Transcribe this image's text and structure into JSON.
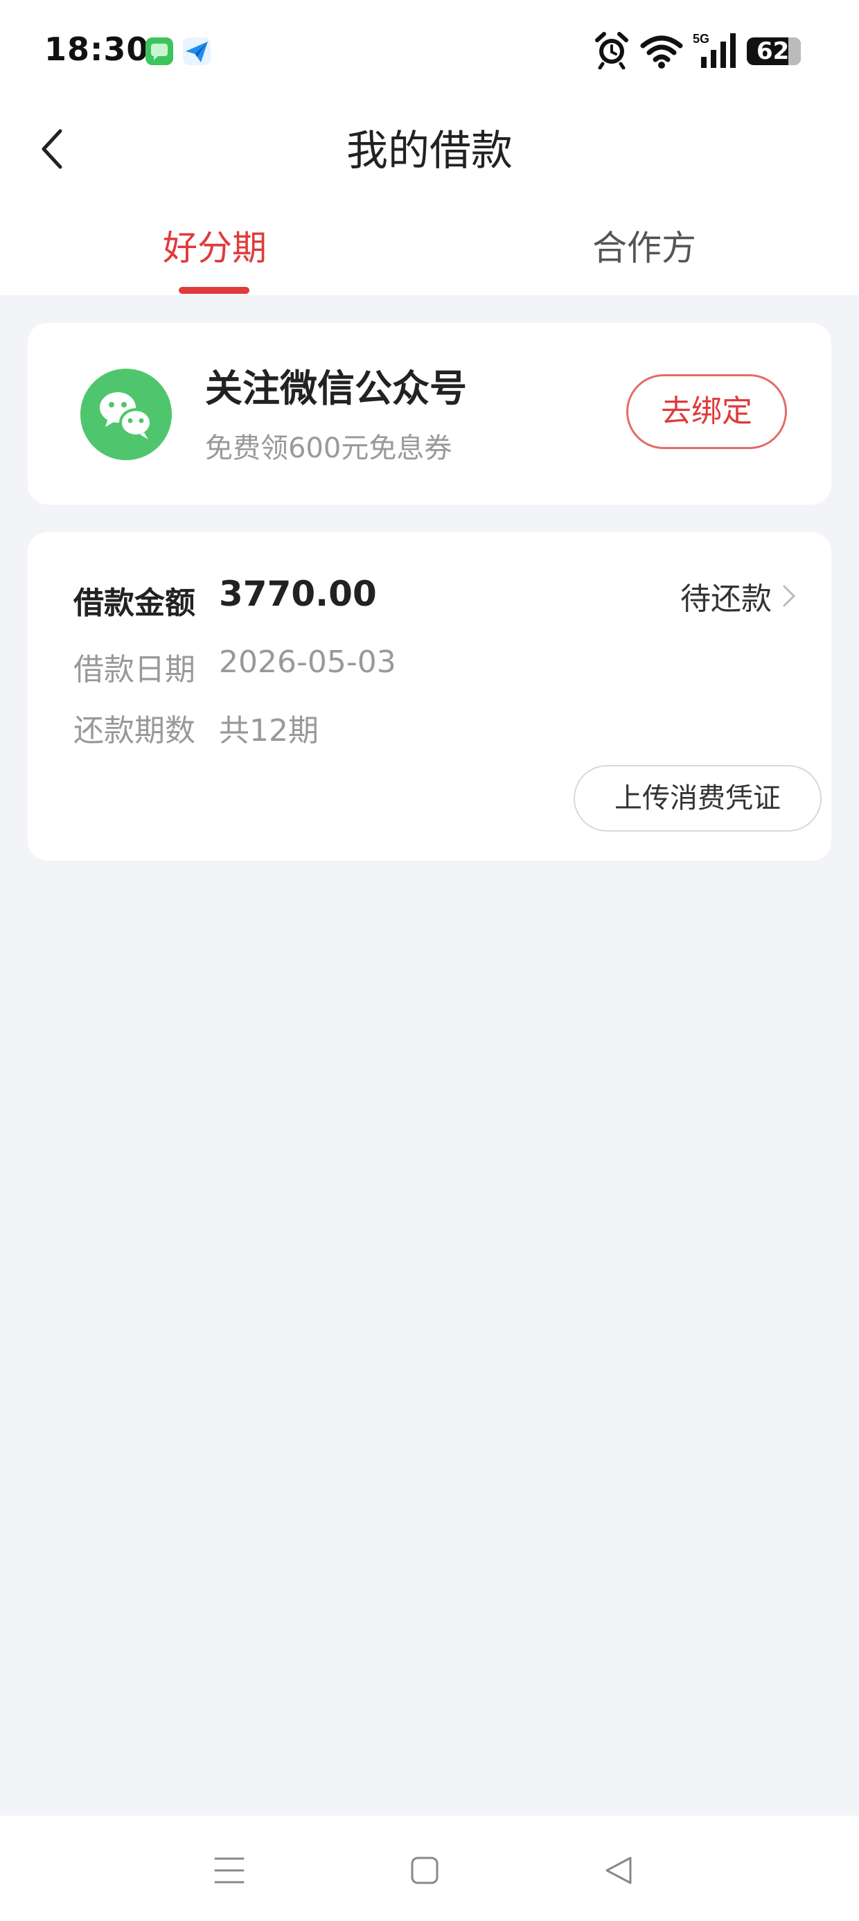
{
  "status_bar": {
    "time": "18:30",
    "battery": "62",
    "network": "5G",
    "icons": [
      "message-app-icon",
      "send-app-icon",
      "alarm-icon",
      "wifi-icon",
      "signal-icon",
      "battery-icon"
    ]
  },
  "header": {
    "title": "我的借款",
    "back_icon": "chevron-left-icon"
  },
  "tabs": [
    {
      "label": "好分期",
      "active": true
    },
    {
      "label": "合作方",
      "active": false
    }
  ],
  "promo": {
    "icon": "wechat-icon",
    "title": "关注微信公众号",
    "subtitle": "免费领600元免息券",
    "button_label": "去绑定"
  },
  "loan": {
    "amount_label": "借款金额",
    "amount_value": "3770.00",
    "status": "待还款",
    "date_label": "借款日期",
    "date_value": "2026-05-03",
    "periods_label": "还款期数",
    "periods_value": "共12期",
    "upload_button": "上传消费凭证"
  },
  "nav_bar": {
    "icons": [
      "menu-icon",
      "home-square-icon",
      "back-triangle-icon"
    ]
  },
  "colors": {
    "accent": "#e03a3a",
    "wechat_green": "#4fc66d",
    "background": "#f3f4f8"
  }
}
